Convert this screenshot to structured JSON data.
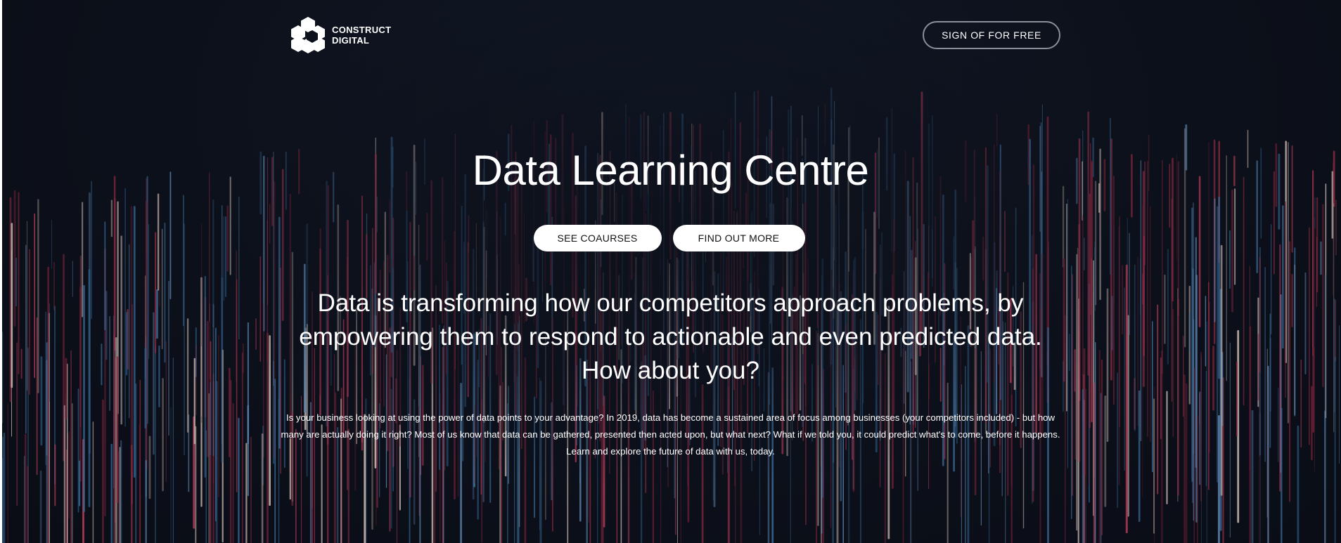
{
  "brand": {
    "line1": "CONSTRUCT",
    "line2": "DIGITAL",
    "logo_icon": "construct-hexagon-c-icon"
  },
  "header": {
    "signup_label": "SIGN OF FOR FREE"
  },
  "hero": {
    "title": "Data Learning Centre",
    "buttons": [
      {
        "label": "SEE COAURSES"
      },
      {
        "label": "FIND OUT MORE"
      }
    ],
    "lead": "Data is transforming how our competitors approach problems, by empowering them to respond to actionable and even predicted data. How about you?",
    "body": "Is your business looking at using the power of data points to your advantage? In 2019, data has become a sustained area of focus among businesses (your competitors included) - but how many are actually doing it right? Most of us know that data can be gathered, presented then acted upon, but what next? What if we told you, it could predict what's to come, before it happens. Learn and explore the future of data with us, today."
  },
  "colors": {
    "background": "#0c101a",
    "streak_colors": [
      "#3a6a96",
      "#2e5a82",
      "#8a2a40",
      "#b03a55",
      "#c8b8b0",
      "#5a7fa8",
      "#6b2035"
    ]
  }
}
